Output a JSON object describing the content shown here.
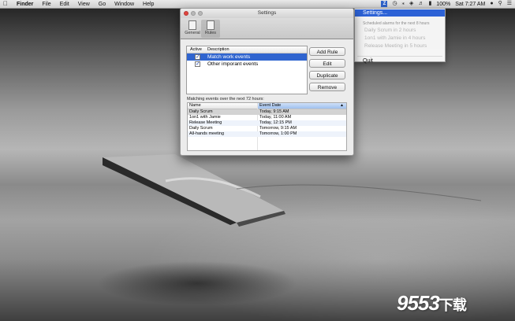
{
  "menubar": {
    "apple_icon": "apple-icon",
    "app_name": "Finder",
    "menus": [
      "File",
      "Edit",
      "View",
      "Go",
      "Window",
      "Help"
    ],
    "status_icons": [
      "z-app-icon",
      "time-machine-icon",
      "bluetooth-icon",
      "wifi-icon",
      "volume-icon"
    ],
    "battery": "100%",
    "clock": "Sat 7:27 AM",
    "user_icon": "user-icon",
    "search_icon": "spotlight-icon",
    "list_icon": "notifications-icon"
  },
  "dropdown": {
    "selected": "Settings...",
    "header": "Scheduled alarms for the next 8 hours",
    "alarms": [
      "Daily Scrum in 2 hours",
      "1on1 with Jamie in 4 hours",
      "Release Meeting in 5 hours"
    ],
    "quit": "Quit"
  },
  "window": {
    "title": "Settings",
    "toolbar": [
      {
        "label": "General",
        "icon": "switch-icon"
      },
      {
        "label": "Rules",
        "icon": "document-icon"
      }
    ],
    "rules": {
      "headers": [
        "Active",
        "Description"
      ],
      "rows": [
        {
          "checked": true,
          "description": "Match work events"
        },
        {
          "checked": true,
          "description": "Other imporant events"
        }
      ]
    },
    "buttons": {
      "add_rule": "Add Rule",
      "edit": "Edit",
      "duplicate": "Duplicate",
      "remove": "Remove"
    },
    "matching_label": "Matching events over the next 72 hours:",
    "events": {
      "headers": [
        "Name",
        "Event Date"
      ],
      "rows": [
        {
          "name": "Daily Scrum",
          "date": "Today, 9:15 AM"
        },
        {
          "name": "1on1 with Jamie",
          "date": "Today, 11:00 AM"
        },
        {
          "name": "Release Meeting",
          "date": "Today, 12:15 PM"
        },
        {
          "name": "Daily Scrum",
          "date": "Tomorrow, 9:15 AM"
        },
        {
          "name": "All-hands meeting",
          "date": "Tomorrow, 1:00 PM"
        }
      ]
    }
  },
  "watermark": {
    "main": "9553",
    "suffix": "下载"
  }
}
